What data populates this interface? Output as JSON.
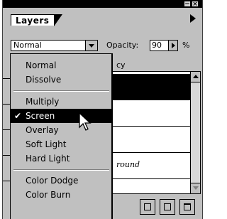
{
  "window": {
    "tab_label": "Layers",
    "minimize_glyph": "−",
    "close_glyph": "×"
  },
  "controls": {
    "blend_mode_value": "Normal",
    "opacity_label": "Opacity:",
    "opacity_value": "90",
    "opacity_unit": "%",
    "hidden_label_fragment": "cy"
  },
  "layers": [
    {
      "name": "",
      "active": true
    },
    {
      "name": "",
      "active": false
    },
    {
      "name": "",
      "active": false
    },
    {
      "name": "round",
      "active": false
    }
  ],
  "blend_menu": {
    "groups": [
      [
        "Normal",
        "Dissolve"
      ],
      [
        "Multiply",
        "Screen",
        "Overlay",
        "Soft Light",
        "Hard Light"
      ],
      [
        "Color Dodge",
        "Color Burn"
      ]
    ],
    "items": {
      "normal": "Normal",
      "dissolve": "Dissolve",
      "multiply": "Multiply",
      "screen": "Screen",
      "overlay": "Overlay",
      "soft_light": "Soft Light",
      "hard_light": "Hard Light",
      "color_dodge": "Color Dodge",
      "color_burn": "Color Burn"
    },
    "checked_item": "Screen",
    "check_glyph": "✔"
  },
  "colors": {
    "panel_bg": "#c0c0c0",
    "selected_bg": "#000000",
    "selected_fg": "#ffffff"
  }
}
